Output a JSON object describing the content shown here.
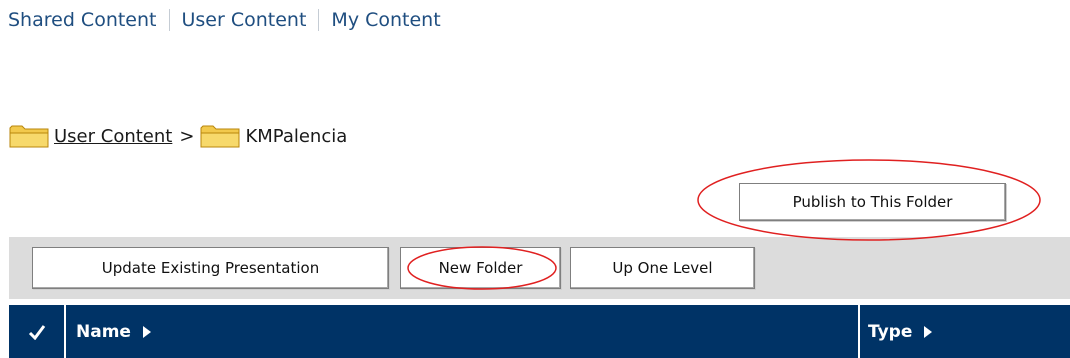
{
  "top_nav": {
    "items": [
      {
        "label": "Shared Content"
      },
      {
        "label": "User Content"
      },
      {
        "label": "My Content"
      }
    ]
  },
  "breadcrumb": {
    "root_label": "User Content",
    "separator": ">",
    "current_label": "KMPalencia"
  },
  "buttons": {
    "publish": "Publish to This Folder",
    "update": "Update Existing Presentation",
    "new_folder": "New Folder",
    "up_level": "Up One Level"
  },
  "table": {
    "check_icon": "checkmark-icon",
    "columns": [
      {
        "label": "Name",
        "sort_icon": "sort-arrow-icon"
      },
      {
        "label": "Type",
        "sort_icon": "sort-arrow-icon"
      }
    ]
  },
  "colors": {
    "link": "#1f4e80",
    "header_bg": "#003366",
    "toolbar_bg": "#dcdcdc",
    "annotation": "#e02020"
  }
}
